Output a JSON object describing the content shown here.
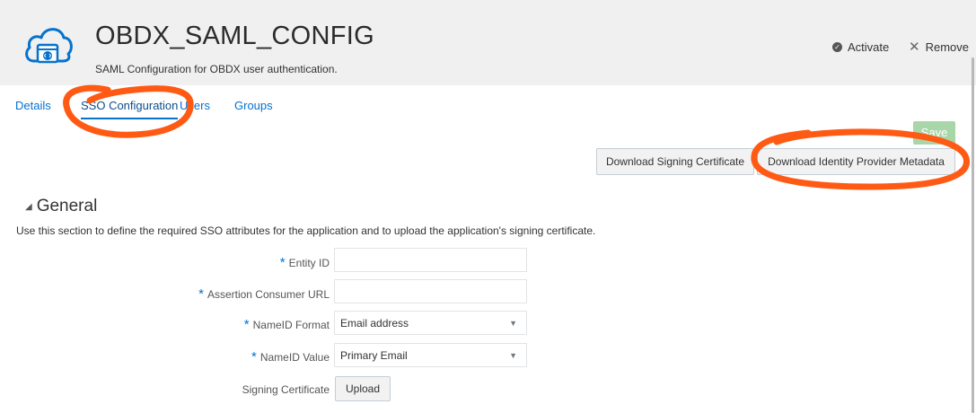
{
  "header": {
    "title": "OBDX_SAML_CONFIG",
    "subtitle": "SAML Configuration for OBDX user authentication.",
    "icon": "cloud-app-icon",
    "actions": {
      "activate_label": "Activate",
      "remove_label": "Remove"
    }
  },
  "tabs": [
    {
      "label": "Details",
      "active": false
    },
    {
      "label": "SSO Configuration",
      "active": true
    },
    {
      "label": "Users",
      "active": false
    },
    {
      "label": "Groups",
      "active": false
    }
  ],
  "toolbar": {
    "save_label": "Save",
    "download_signing_cert_label": "Download Signing Certificate",
    "download_idp_metadata_label": "Download Identity Provider Metadata"
  },
  "general": {
    "title": "General",
    "description": "Use this section to define the required SSO attributes for the application and to upload the application's signing certificate.",
    "fields": {
      "entity_id": {
        "label": "Entity ID",
        "required": true,
        "value": ""
      },
      "acs_url": {
        "label": "Assertion Consumer URL",
        "required": true,
        "value": ""
      },
      "nameid_format": {
        "label": "NameID Format",
        "required": true,
        "value": "Email address"
      },
      "nameid_value": {
        "label": "NameID Value",
        "required": true,
        "value": "Primary Email"
      },
      "signing_cert": {
        "label": "Signing Certificate",
        "required": false,
        "button_label": "Upload"
      }
    }
  },
  "colors": {
    "accent": "#0572ce",
    "save_disabled": "#a9d6a9",
    "annotation": "#ff5a14",
    "header_bg": "#f0f0f0"
  }
}
